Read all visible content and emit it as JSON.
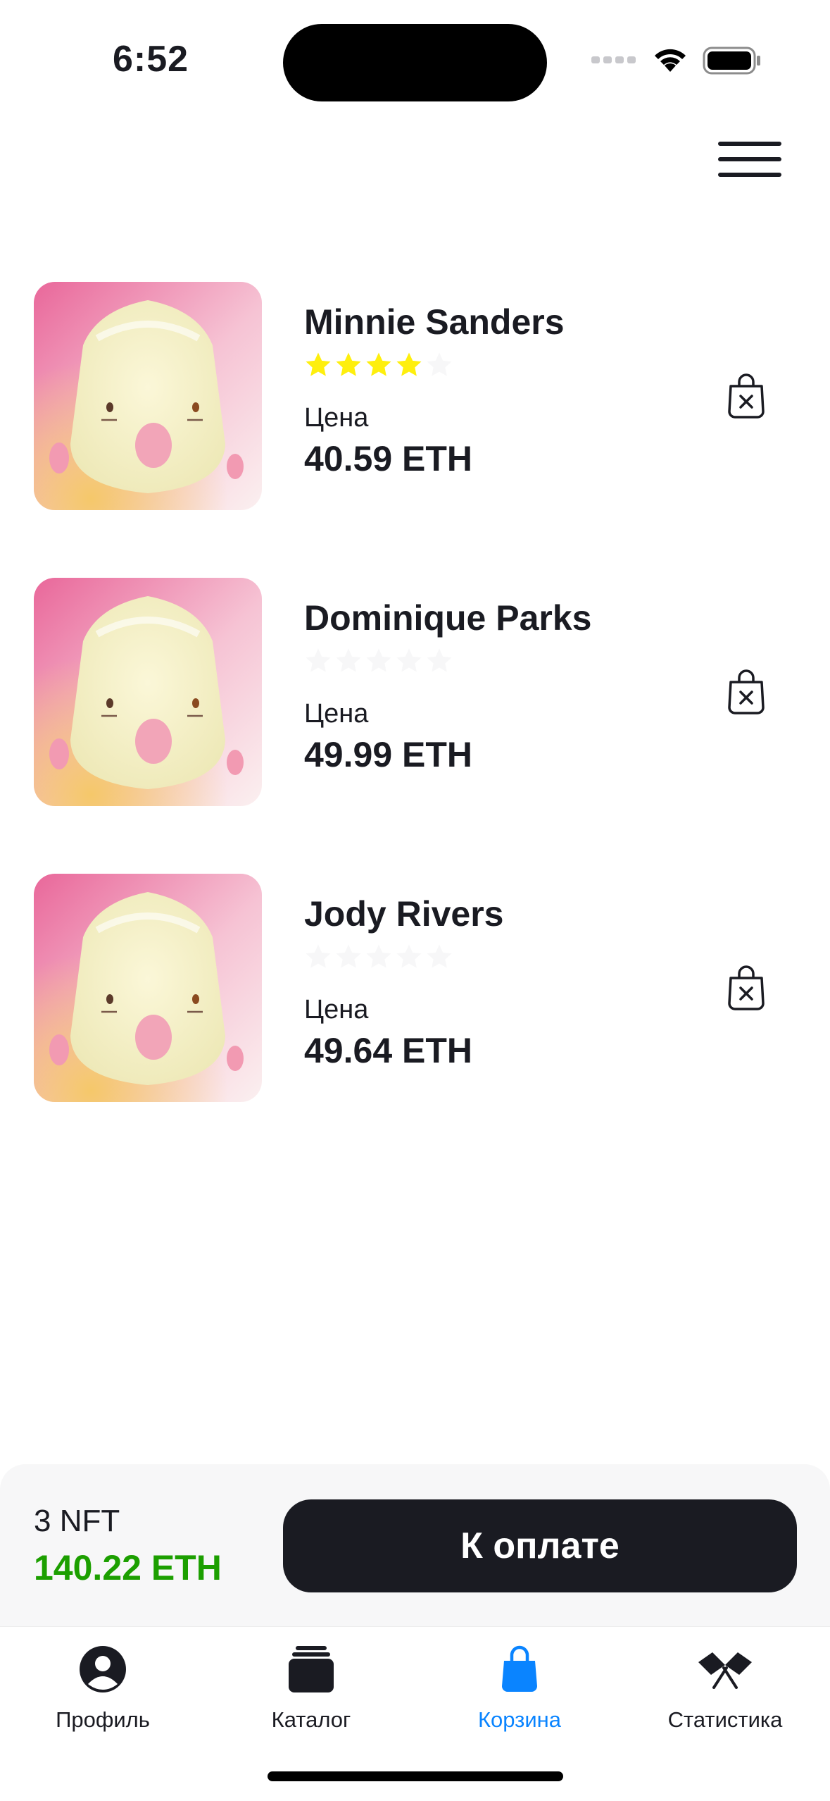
{
  "status_bar": {
    "time": "6:52"
  },
  "cart": {
    "items": [
      {
        "name": "Minnie Sanders",
        "rating": 4,
        "price_label": "Цена",
        "price": "40.59 ETH"
      },
      {
        "name": "Dominique Parks",
        "rating": 0,
        "price_label": "Цена",
        "price": "49.99 ETH"
      },
      {
        "name": "Jody Rivers",
        "rating": 0,
        "price_label": "Цена",
        "price": "49.64 ETH"
      }
    ]
  },
  "checkout": {
    "count": "3 NFT",
    "total": "140.22 ETH",
    "pay_label": "К оплате"
  },
  "tabs": [
    {
      "label": "Профиль",
      "icon": "profile-icon",
      "active": false
    },
    {
      "label": "Каталог",
      "icon": "catalog-icon",
      "active": false
    },
    {
      "label": "Корзина",
      "icon": "cart-icon",
      "active": true
    },
    {
      "label": "Статистика",
      "icon": "statistics-icon",
      "active": false
    }
  ],
  "colors": {
    "text": "#1A1B22",
    "star_active": "#FEEF0D",
    "star_inactive": "#F7F7F8",
    "total_green": "#1C9F00",
    "tab_active": "#0A84FF",
    "panel_bg": "#F7F7F8"
  }
}
